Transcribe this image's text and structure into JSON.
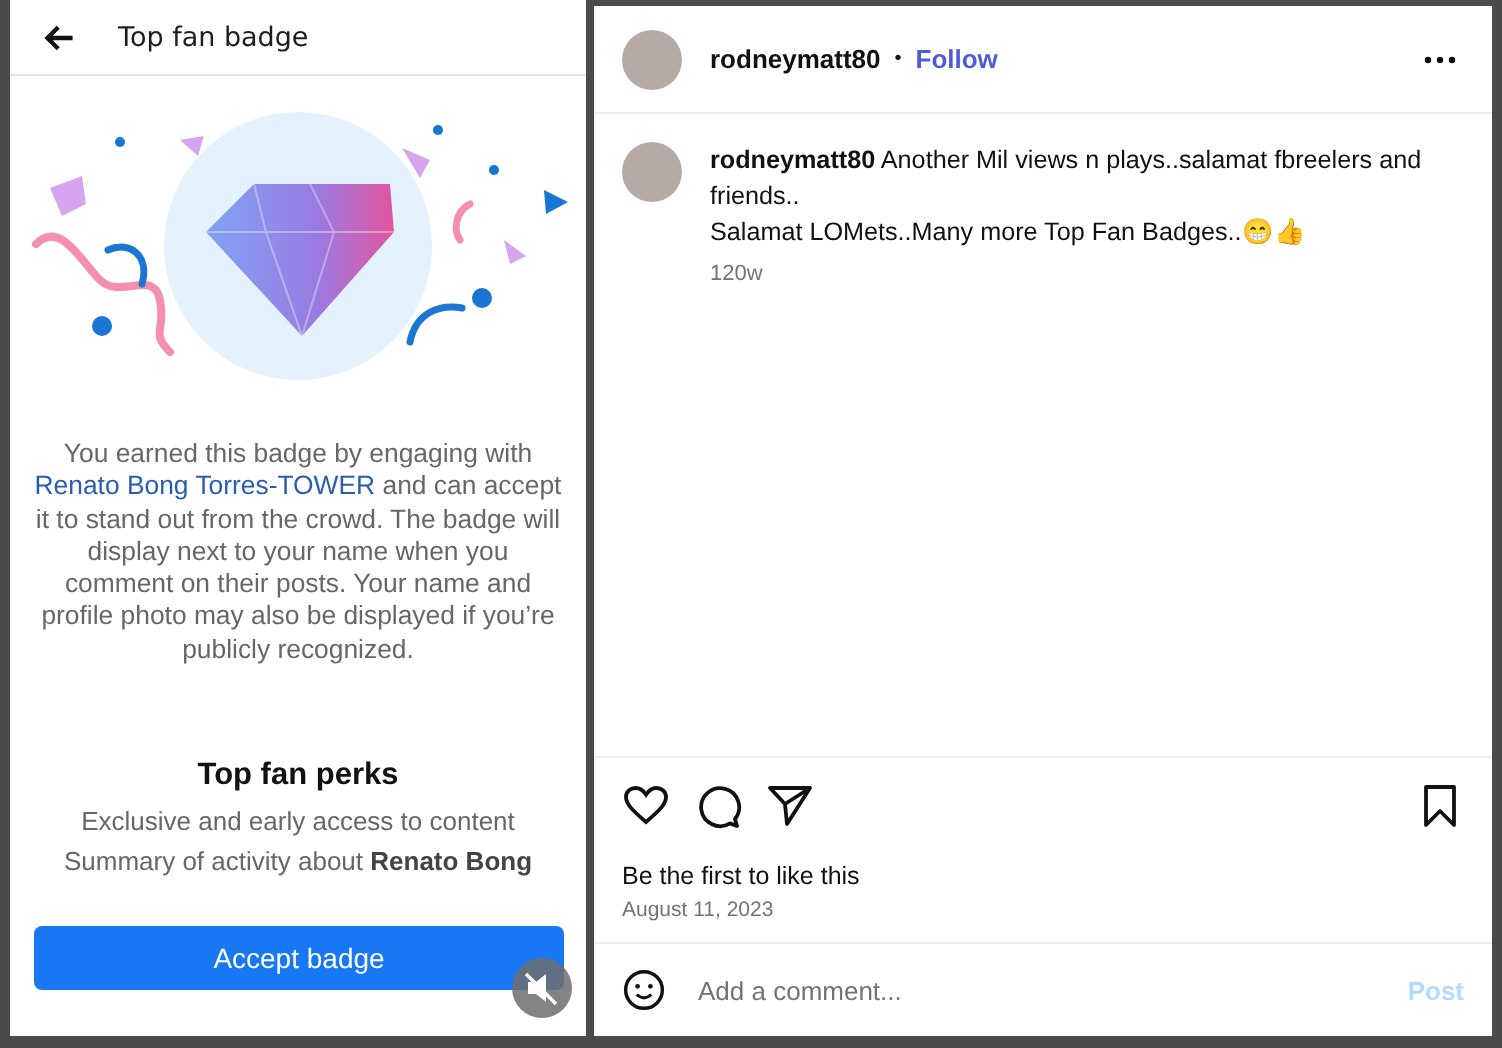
{
  "badge_panel": {
    "title": "Top fan badge",
    "description": {
      "before": "You earned this badge by engaging with",
      "link": "Renato Bong Torres-TOWER",
      "after": "and can accept it to stand out from the crowd. The badge will display next to your name when you comment on their posts. Your name and profile photo may also be displayed if you’re publicly recognized."
    },
    "perks_title": "Top fan perks",
    "perks": [
      "Exclusive and early access to content",
      "Summary of activity about **Renato Bong**"
    ],
    "accept_button": "Accept badge",
    "muted": true
  },
  "post": {
    "username": "rodneymatt80",
    "separator": "•",
    "follow": "Follow",
    "caption": {
      "username": "rodneymatt80",
      "lines": [
        "Another Mil views n plays..salamat fbreelers and friends..",
        "Salamat LOMets..Many more Top Fan Badges..😁👍"
      ]
    },
    "age": "120w",
    "likes_text": "Be the first to like this",
    "date": "August 11, 2023",
    "comment": {
      "placeholder": "Add a comment...",
      "post_button": "Post",
      "post_disabled": true
    }
  }
}
